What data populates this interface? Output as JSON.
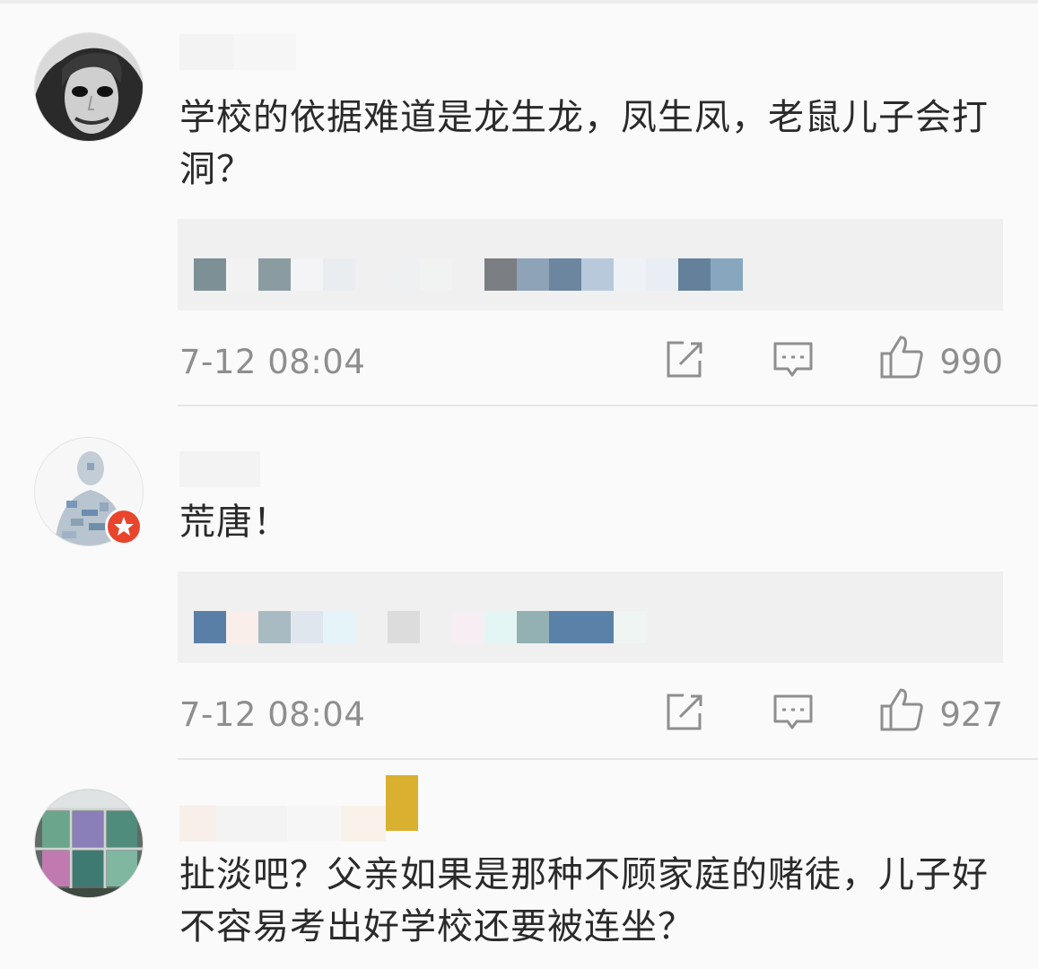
{
  "comments": [
    {
      "text": "学校的依据难道是龙生龙，凤生凤，老鼠儿子会打洞？",
      "timestamp": "7-12 08:04",
      "like_count": "990",
      "avatar_icon": "joker-portrait-avatar",
      "verified": false
    },
    {
      "text": "荒唐！",
      "timestamp": "7-12 08:04",
      "like_count": "927",
      "avatar_icon": "word-cloud-portrait-avatar",
      "verified": true
    },
    {
      "text": "扯淡吧？父亲如果是那种不顾家庭的赌徒，儿子好不容易考出好学校还要被连坐？",
      "avatar_icon": "glass-window-photo-avatar",
      "verified": false
    }
  ],
  "icons": {
    "share": "share-icon",
    "reply": "comment-icon",
    "like": "thumbs-up-icon"
  },
  "colors": {
    "background": "#fafafa",
    "meta_text": "#8e8e8e",
    "badge": "#e8452c"
  }
}
